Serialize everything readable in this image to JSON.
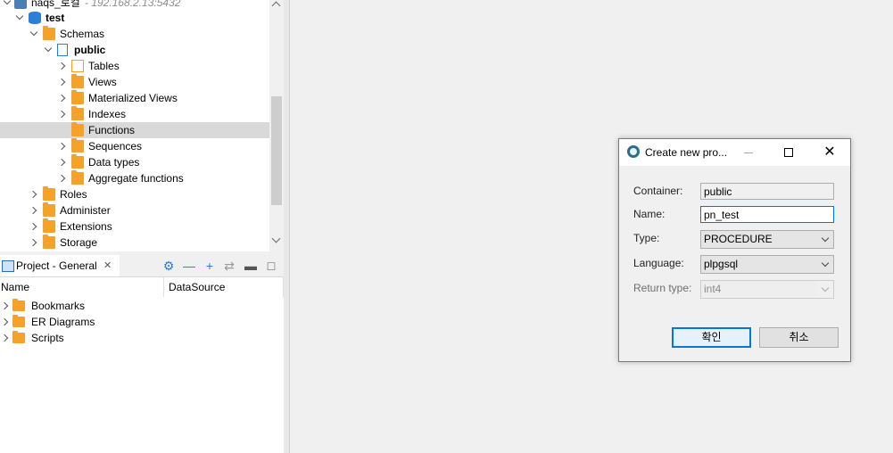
{
  "navigator": {
    "connection": {
      "label": "naqs_로컬",
      "host": " - 192.168.2.13:5432"
    },
    "database": "test",
    "schemas": "Schemas",
    "schema": "public",
    "items": [
      "Tables",
      "Views",
      "Materialized Views",
      "Indexes",
      "Functions",
      "Sequences",
      "Data types",
      "Aggregate functions"
    ],
    "selected": "Functions",
    "other": [
      "Roles",
      "Administer",
      "Extensions",
      "Storage"
    ]
  },
  "project": {
    "tab_title": "Project - General",
    "columns": [
      "Name",
      "DataSource"
    ],
    "rows": [
      "Bookmarks",
      "ER Diagrams",
      "Scripts"
    ]
  },
  "dialog": {
    "title": "Create new pro...",
    "fields": {
      "container": {
        "label": "Container:",
        "value": "public"
      },
      "name": {
        "label": "Name:",
        "value": "pn_test"
      },
      "type": {
        "label": "Type:",
        "value": "PROCEDURE"
      },
      "language": {
        "label": "Language:",
        "value": "plpgsql"
      },
      "return_type": {
        "label": "Return type:",
        "value": "int4"
      }
    },
    "ok_label": "확인",
    "cancel_label": "취소"
  },
  "colors": {
    "accent": "#0078d7",
    "folder": "#f4a22a",
    "selection": "#d9d9d9"
  }
}
